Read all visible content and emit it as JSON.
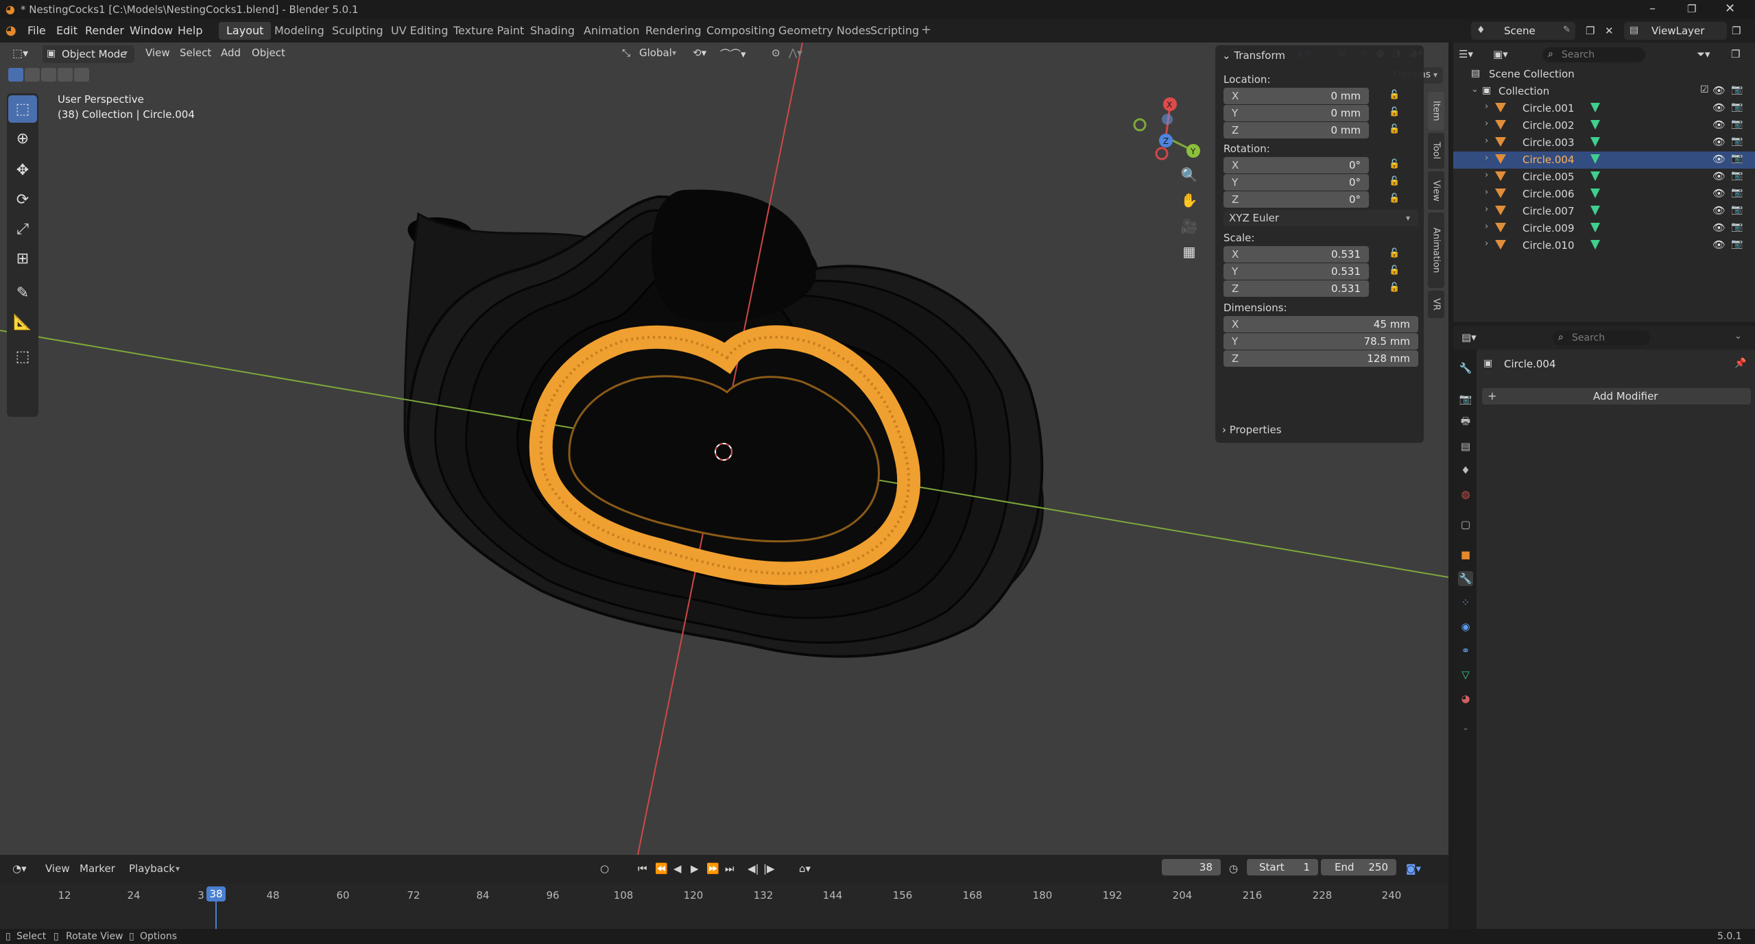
{
  "window": {
    "title": "* NestingCocks1 [C:\\Models\\NestingCocks1.blend] - Blender 5.0.1"
  },
  "menu": {
    "items": [
      "File",
      "Edit",
      "Render",
      "Window",
      "Help"
    ],
    "workspaces": [
      "Layout",
      "Modeling",
      "Sculpting",
      "UV Editing",
      "Texture Paint",
      "Shading",
      "Animation",
      "Rendering",
      "Compositing",
      "Geometry Nodes",
      "Scripting"
    ],
    "active_workspace": "Layout",
    "add_workspace": "+",
    "scene": "Scene",
    "view_layer": "ViewLayer"
  },
  "viewport_header": {
    "mode": "Object Mode",
    "menus": [
      "View",
      "Select",
      "Add",
      "Object"
    ],
    "transform_orientation": "Global",
    "options": "Options"
  },
  "viewport": {
    "perspective_label": "User Perspective",
    "collection_label": "(38) Collection | Circle.004",
    "gizmo_axes": [
      "X",
      "Y",
      "Z"
    ],
    "colors": {
      "background": "#3e3e3e",
      "selected_mesh": "#f0a030",
      "x_axis": "#d04848",
      "y_axis": "#7fa83a",
      "wire": "#0a0a0a"
    }
  },
  "npanel": {
    "section": "Transform",
    "location_label": "Location:",
    "location": [
      {
        "axis": "X",
        "value": "0 mm"
      },
      {
        "axis": "Y",
        "value": "0 mm"
      },
      {
        "axis": "Z",
        "value": "0 mm"
      }
    ],
    "rotation_label": "Rotation:",
    "rotation": [
      {
        "axis": "X",
        "value": "0°"
      },
      {
        "axis": "Y",
        "value": "0°"
      },
      {
        "axis": "Z",
        "value": "0°"
      }
    ],
    "rotation_mode": "XYZ Euler",
    "scale_label": "Scale:",
    "scale": [
      {
        "axis": "X",
        "value": "0.531"
      },
      {
        "axis": "Y",
        "value": "0.531"
      },
      {
        "axis": "Z",
        "value": "0.531"
      }
    ],
    "dimensions_label": "Dimensions:",
    "dimensions": [
      {
        "axis": "X",
        "value": "45 mm"
      },
      {
        "axis": "Y",
        "value": "78.5 mm"
      },
      {
        "axis": "Z",
        "value": "128 mm"
      }
    ],
    "properties_section": "Properties",
    "tabs": [
      "Item",
      "Tool",
      "View",
      "Animation",
      "VR"
    ]
  },
  "timeline": {
    "menus": [
      "View",
      "Marker",
      "Playback"
    ],
    "current_frame": "38",
    "start_label": "Start",
    "start": "1",
    "end_label": "End",
    "end": "250",
    "ticks": [
      "12",
      "24",
      "3",
      "48",
      "60",
      "72",
      "84",
      "96",
      "108",
      "120",
      "132",
      "144",
      "156",
      "168",
      "180",
      "192",
      "204",
      "216",
      "228",
      "240"
    ],
    "frame_marker": "38"
  },
  "outliner": {
    "search_placeholder": "Search",
    "root": "Scene Collection",
    "collection": "Collection",
    "objects": [
      "Circle.001",
      "Circle.002",
      "Circle.003",
      "Circle.004",
      "Circle.005",
      "Circle.006",
      "Circle.007",
      "Circle.009",
      "Circle.010"
    ],
    "selected": "Circle.004"
  },
  "properties": {
    "search_placeholder": "Search",
    "object_name": "Circle.004",
    "add_modifier": "Add Modifier"
  },
  "statusbar": {
    "select": "Select",
    "rotate_view": "Rotate View",
    "options": "Options",
    "version": "5.0.1"
  }
}
